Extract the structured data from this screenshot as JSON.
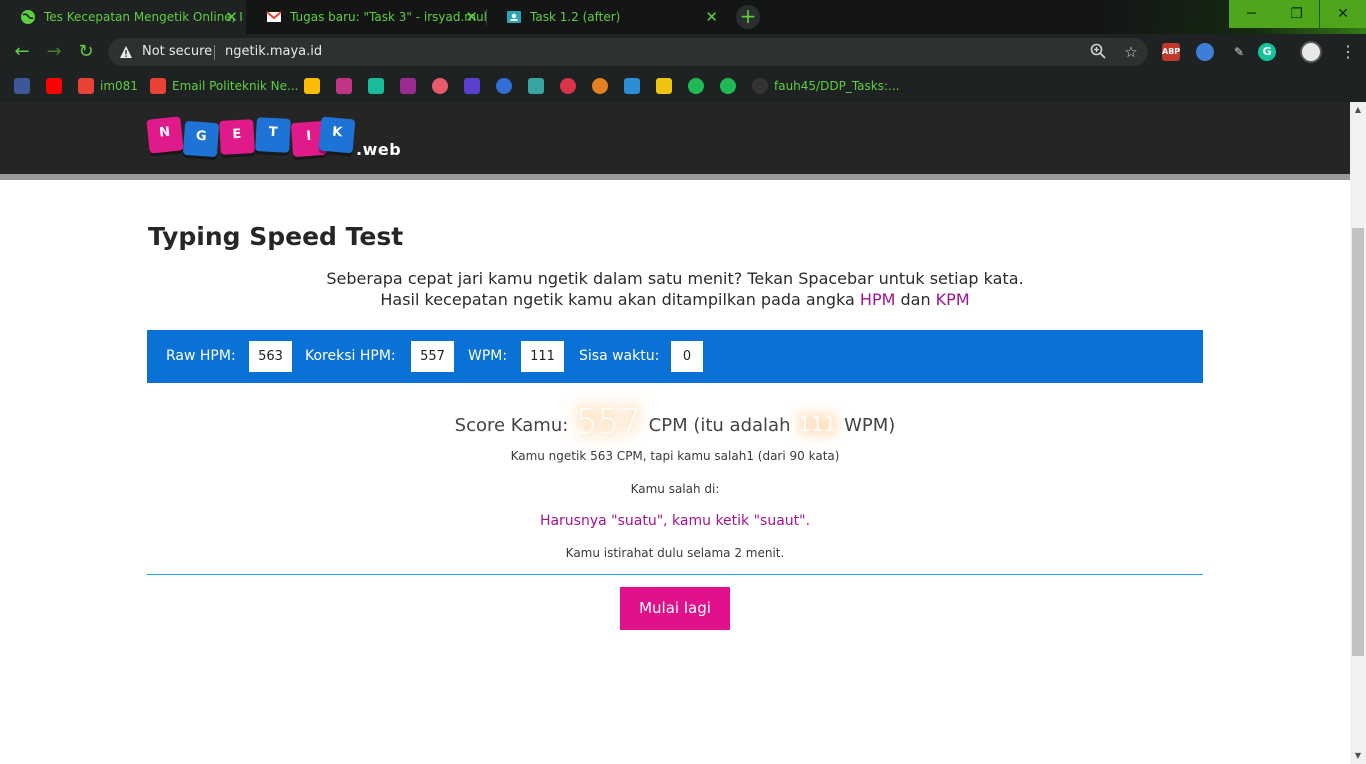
{
  "tabs": [
    {
      "title": "Tes Kecepatan Mengetik Online, I",
      "icon": "globe-icon",
      "active": true
    },
    {
      "title": "Tugas baru: \"Task 3\" - irsyad.muh",
      "icon": "gmail-icon",
      "active": false
    },
    {
      "title": "Task 1.2 (after)",
      "icon": "classroom-icon",
      "active": false
    }
  ],
  "address_bar": {
    "security": "Not secure",
    "url": "ngetik.maya.id"
  },
  "bookmarks": [
    {
      "label": "",
      "icon": "facebook-icon",
      "color": "#3b5998"
    },
    {
      "label": "",
      "icon": "youtube-icon",
      "color": "#ff0000"
    },
    {
      "label": "im081",
      "icon": "gmail-icon",
      "color": "#ea4335"
    },
    {
      "label": "Email Politeknik Ne...",
      "icon": "gmail-icon",
      "color": "#ea4335"
    },
    {
      "label": "",
      "icon": "drive-icon",
      "color": "#fbbc04"
    },
    {
      "label": "",
      "icon": "instagram-icon",
      "color": "#c13584"
    },
    {
      "label": "",
      "icon": "app-icon",
      "color": "#1abc9c"
    },
    {
      "label": "",
      "icon": "app-icon",
      "color": "#9b2c8f"
    },
    {
      "label": "",
      "icon": "app-icon",
      "color": "#e85a6b"
    },
    {
      "label": "",
      "icon": "vp-icon",
      "color": "#5b3fd0"
    },
    {
      "label": "",
      "icon": "app-icon",
      "color": "#2f6fd6"
    },
    {
      "label": "",
      "icon": "app-icon",
      "color": "#35a7a0"
    },
    {
      "label": "",
      "icon": "heart-icon",
      "color": "#d9334a"
    },
    {
      "label": "",
      "icon": "app-icon",
      "color": "#e67e22"
    },
    {
      "label": "",
      "icon": "app-icon",
      "color": "#2c8fd6"
    },
    {
      "label": "",
      "icon": "app-icon",
      "color": "#f1c40f"
    },
    {
      "label": "",
      "icon": "spotify-icon",
      "color": "#1db954"
    },
    {
      "label": "",
      "icon": "spotify-icon",
      "color": "#1db954"
    },
    {
      "label": "fauh45/DDP_Tasks:...",
      "icon": "github-icon",
      "color": "#333333"
    }
  ],
  "site": {
    "logo_letters": [
      "N",
      "G",
      "E",
      "T",
      "I",
      "K"
    ],
    "logo_suffix": ".web",
    "title": "Typing Speed Test",
    "intro_line1": "Seberapa cepat jari kamu ngetik dalam satu menit? Tekan Spacebar untuk setiap kata.",
    "intro_line2_pre": "Hasil kecepatan ngetik kamu akan ditampilkan pada angka ",
    "intro_hpm": "HPM",
    "intro_dan": " dan ",
    "intro_kpm": "KPM"
  },
  "stats": {
    "raw_label": "Raw HPM:",
    "raw_value": "563",
    "koreksi_label": "Koreksi HPM:",
    "koreksi_value": "557",
    "wpm_label": "WPM:",
    "wpm_value": "111",
    "sisa_label": "Sisa waktu:",
    "sisa_value": "0"
  },
  "result": {
    "score_prefix": "Score Kamu: ",
    "cpm": "557",
    "cpm_mid": " CPM (itu adalah ",
    "wpm": "111",
    "wpm_suffix": " WPM)",
    "summary": "Kamu ngetik 563 CPM, tapi kamu salah1 (dari 90 kata)",
    "mistakes_heading": "Kamu salah di:",
    "mistake": "Harusnya \"suatu\", kamu ketik \"suaut\".",
    "rest": "Kamu istirahat dulu selama 2 menit.",
    "restart_label": "Mulai lagi"
  },
  "colors": {
    "accent_blue": "#0a72d6",
    "accent_magenta": "#e0118a",
    "highlight_purple": "#a0148c",
    "chrome_green": "#5fcf3f"
  }
}
